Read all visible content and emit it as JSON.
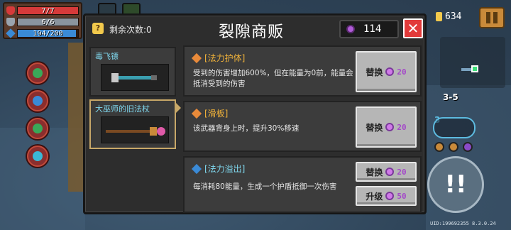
{
  "hud": {
    "hp": "7/7",
    "armor": "6/6",
    "energy": "194/200",
    "coins": "634"
  },
  "minimap": {
    "level": "3-5"
  },
  "weapon_slot": {
    "number": "3"
  },
  "uid": "UID:199692355  8.3.0.24",
  "shop": {
    "refresh_label": "剩余次数:0",
    "title": "裂隙商贩",
    "gems": "114",
    "close_symbol": "✕",
    "weapons": [
      {
        "name": "毒飞镖"
      },
      {
        "name": "大巫师的旧法杖"
      }
    ],
    "items": [
      {
        "title": "[法力护体]",
        "desc": "受到的伤害增加600%，但在能量为0前，能量会抵消受到的伤害",
        "actions": [
          {
            "label": "替换",
            "cost": "20"
          }
        ]
      },
      {
        "title": "[滑板]",
        "desc": "该武器背身上时，提升30%移速",
        "actions": [
          {
            "label": "替换",
            "cost": "20"
          }
        ]
      },
      {
        "title": "[法力溢出]",
        "desc": "每消耗80能量，生成一个护盾抵御一次伤害",
        "actions": [
          {
            "label": "替换",
            "cost": "20"
          },
          {
            "label": "升级",
            "cost": "50"
          }
        ]
      }
    ]
  },
  "colors": {
    "hp": "#d63a3a",
    "armor": "#9aa4ae",
    "energy": "#3a8ad6",
    "accent_orange": "#f0b23a",
    "accent_blue": "#7fd7ee",
    "close_red": "#e23a3a"
  }
}
